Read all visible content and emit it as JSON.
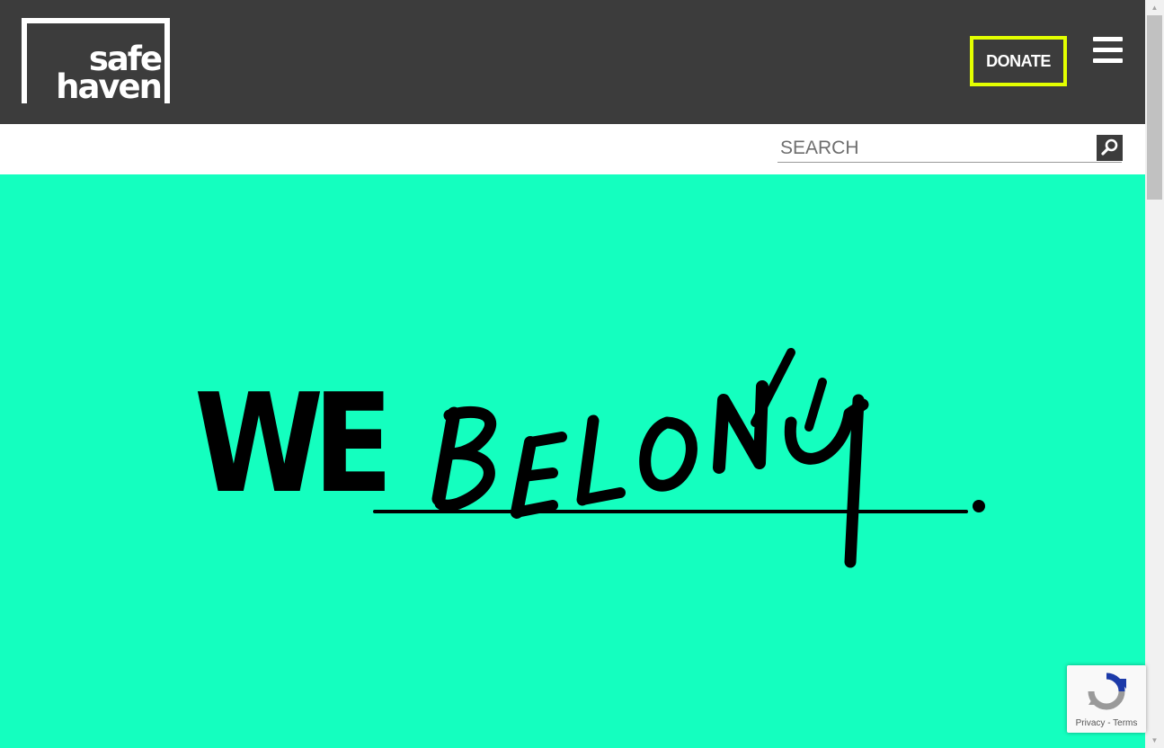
{
  "header": {
    "logo": {
      "line1": "safe",
      "line2": "haven"
    },
    "donate_label": "DONATE",
    "menu_icon": "hamburger-menu-icon"
  },
  "search": {
    "placeholder": "SEARCH",
    "value": "",
    "button_icon": "search-icon"
  },
  "hero": {
    "line_we": "WE",
    "handwritten_word": "BELONG",
    "punctuation": "."
  },
  "recaptcha": {
    "privacy_label": "Privacy",
    "separator": " - ",
    "terms_label": "Terms"
  },
  "colors": {
    "header_bg": "#3c3c3c",
    "donate_border": "#e3ff00",
    "hero_bg": "#14ffbf",
    "text_white": "#ffffff",
    "ink": "#000000"
  }
}
